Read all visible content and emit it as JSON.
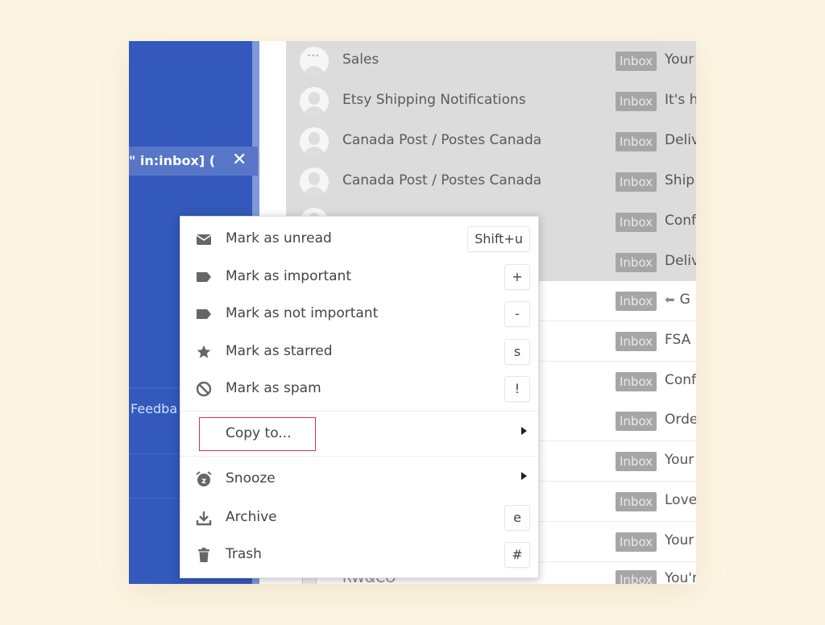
{
  "sidebar": {
    "search_query": "\" in:inbox] (",
    "close_label": "✕",
    "feedback_label": "Feedba"
  },
  "messages": [
    {
      "sender": "Sales",
      "label": "Inbox",
      "subject": "Your",
      "selected": true,
      "avatar": "dots"
    },
    {
      "sender": "Etsy Shipping Notifications",
      "label": "Inbox",
      "subject": "It's h",
      "selected": true
    },
    {
      "sender": "Canada Post / Postes Canada",
      "label": "Inbox",
      "subject": "Deliv",
      "selected": true
    },
    {
      "sender": "Canada Post / Postes Canada",
      "label": "Inbox",
      "subject": "Ship",
      "selected": true
    },
    {
      "sender": "",
      "label": "Inbox",
      "subject": "Conf",
      "selected": true
    },
    {
      "sender": "",
      "label": "Inbox",
      "subject": "Deliv",
      "selected": true
    },
    {
      "sender": "",
      "label": "Inbox",
      "subject": "G",
      "selected": false,
      "replied": true
    },
    {
      "sender": "",
      "label": "Inbox",
      "subject": "FSA",
      "selected": false
    },
    {
      "sender": "",
      "label": "Inbox",
      "subject": "Conf",
      "selected": false
    },
    {
      "sender": "",
      "label": "Inbox",
      "subject": "Orde",
      "selected": false
    },
    {
      "sender": "",
      "label": "Inbox",
      "subject": "Your",
      "selected": false
    },
    {
      "sender": "",
      "label": "Inbox",
      "subject": "Love",
      "selected": false
    },
    {
      "sender": "",
      "label": "Inbox",
      "subject": "Your",
      "selected": false
    },
    {
      "sender": "RW&CO",
      "label": "Inbox",
      "subject": "You'r",
      "selected": false
    }
  ],
  "context_menu": {
    "items": [
      {
        "label": "Mark as unread",
        "icon": "envelope-icon",
        "shortcut": "Shift+u"
      },
      {
        "label": "Mark as important",
        "icon": "label-icon",
        "shortcut": "+"
      },
      {
        "label": "Mark as not important",
        "icon": "label-icon",
        "shortcut": "-"
      },
      {
        "label": "Mark as starred",
        "icon": "star-icon",
        "shortcut": "s"
      },
      {
        "label": "Mark as spam",
        "icon": "block-icon",
        "shortcut": "!"
      },
      {
        "label": "Copy to...",
        "icon": "",
        "submenu": true,
        "highlighted": true
      },
      {
        "label": "Snooze",
        "icon": "alarm-clock-icon",
        "submenu": true
      },
      {
        "label": "Archive",
        "icon": "archive-download-icon",
        "shortcut": "e"
      },
      {
        "label": "Trash",
        "icon": "trash-icon",
        "shortcut": "#"
      }
    ]
  },
  "colors": {
    "sidebar_blue": "#3359bd",
    "highlight_red": "#d9343c",
    "badge_gray": "#a6a6a6",
    "selected_row": "#dcdcdc"
  }
}
